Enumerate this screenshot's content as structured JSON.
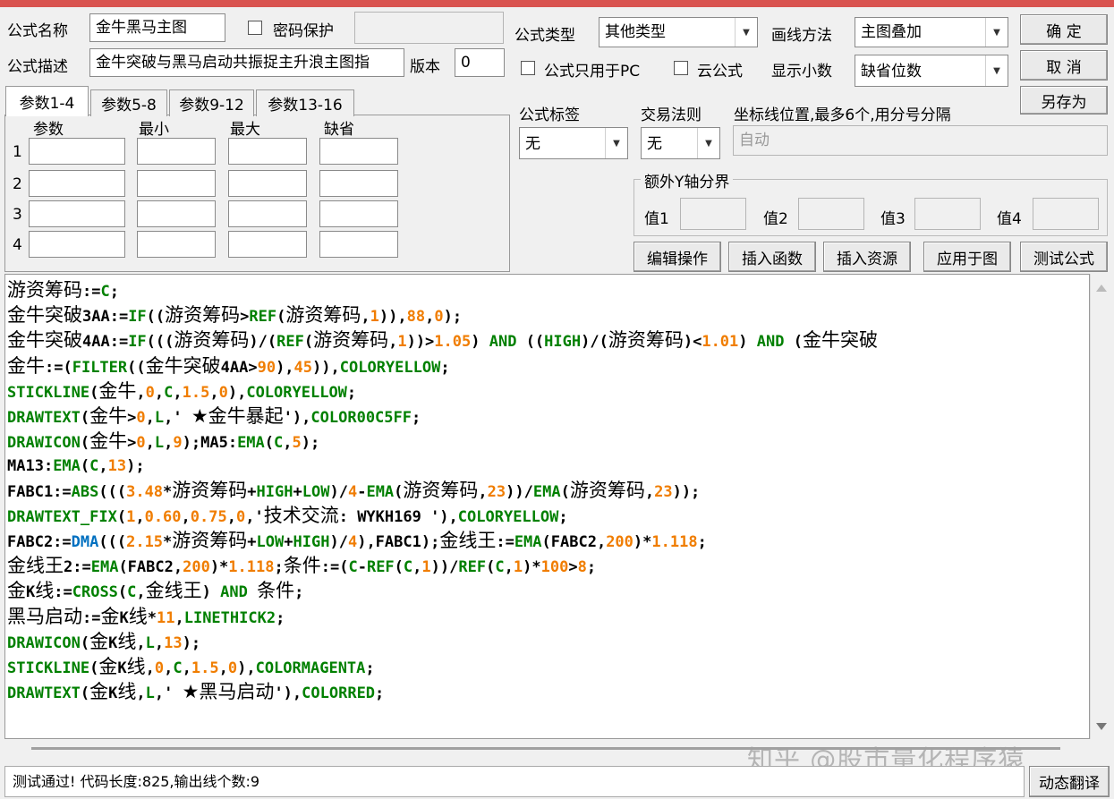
{
  "header": {
    "name_label": "公式名称",
    "name_value": "金牛黑马主图",
    "password_label": "密码保护",
    "password_value": "",
    "desc_label": "公式描述",
    "desc_value": "金牛突破与黑马启动共振捉主升浪主图指",
    "version_label": "版本",
    "version_value": "0",
    "type_label": "公式类型",
    "type_value": "其他类型",
    "draw_label": "画线方法",
    "draw_value": "主图叠加",
    "pc_only_label": "公式只用于PC",
    "cloud_label": "云公式",
    "decimal_label": "显示小数",
    "decimal_value": "缺省位数"
  },
  "buttons": {
    "ok": "确  定",
    "cancel": "取  消",
    "save_as": "另存为",
    "edit_ops": "编辑操作",
    "insert_func": "插入函数",
    "insert_res": "插入资源",
    "apply_chart": "应用于图",
    "test": "测试公式",
    "translate": "动态翻译"
  },
  "tabs": [
    "参数1-4",
    "参数5-8",
    "参数9-12",
    "参数13-16"
  ],
  "params": {
    "headers": [
      "参数",
      "最小",
      "最大",
      "缺省"
    ],
    "rows": [
      "1",
      "2",
      "3",
      "4"
    ]
  },
  "right_panel": {
    "tag_label": "公式标签",
    "tag_value": "无",
    "rule_label": "交易法则",
    "rule_value": "无",
    "coord_label": "坐标线位置,最多6个,用分号分隔",
    "coord_value": "自动",
    "yaxis_label": "额外Y轴分界",
    "val1": "值1",
    "val2": "值2",
    "val3": "值3",
    "val4": "值4"
  },
  "code_lines": [
    [
      [
        "t",
        "游资筹码:="
      ],
      [
        "k",
        "C"
      ],
      [
        "t",
        ";"
      ]
    ],
    [
      [
        "t",
        "金牛突破3AA:="
      ],
      [
        "k",
        "IF"
      ],
      [
        "t",
        "((游资筹码>"
      ],
      [
        "k",
        "REF"
      ],
      [
        "t",
        "(游资筹码,"
      ],
      [
        "n",
        "1"
      ],
      [
        "t",
        ")),"
      ],
      [
        "n",
        "88"
      ],
      [
        "t",
        ","
      ],
      [
        "n",
        "0"
      ],
      [
        "t",
        ");"
      ]
    ],
    [
      [
        "t",
        "金牛突破4AA:="
      ],
      [
        "k",
        "IF"
      ],
      [
        "t",
        "(((游资筹码)/("
      ],
      [
        "k",
        "REF"
      ],
      [
        "t",
        "(游资筹码,"
      ],
      [
        "n",
        "1"
      ],
      [
        "t",
        "))>"
      ],
      [
        "n",
        "1.05"
      ],
      [
        "t",
        ") "
      ],
      [
        "k",
        "AND"
      ],
      [
        "t",
        " (("
      ],
      [
        "k",
        "HIGH"
      ],
      [
        "t",
        ")/(游资筹码)<"
      ],
      [
        "n",
        "1.01"
      ],
      [
        "t",
        ") "
      ],
      [
        "k",
        "AND"
      ],
      [
        "t",
        " (金牛突破"
      ]
    ],
    [
      [
        "t",
        "金牛:=("
      ],
      [
        "k",
        "FILTER"
      ],
      [
        "t",
        "((金牛突破4AA>"
      ],
      [
        "n",
        "90"
      ],
      [
        "t",
        "),"
      ],
      [
        "n",
        "45"
      ],
      [
        "t",
        ")),"
      ],
      [
        "k",
        "COLORYELLOW"
      ],
      [
        "t",
        ";"
      ]
    ],
    [
      [
        "k",
        "STICKLINE"
      ],
      [
        "t",
        "(金牛,"
      ],
      [
        "n",
        "0"
      ],
      [
        "t",
        ","
      ],
      [
        "k",
        "C"
      ],
      [
        "t",
        ","
      ],
      [
        "n",
        "1.5"
      ],
      [
        "t",
        ","
      ],
      [
        "n",
        "0"
      ],
      [
        "t",
        "),"
      ],
      [
        "k",
        "COLORYELLOW"
      ],
      [
        "t",
        ";"
      ]
    ],
    [
      [
        "k",
        "DRAWTEXT"
      ],
      [
        "t",
        "(金牛>"
      ],
      [
        "n",
        "0"
      ],
      [
        "t",
        ","
      ],
      [
        "k",
        "L"
      ],
      [
        "t",
        ",' ★金牛暴起'),"
      ],
      [
        "k",
        "COLOR00C5FF"
      ],
      [
        "t",
        ";"
      ]
    ],
    [
      [
        "k",
        "DRAWICON"
      ],
      [
        "t",
        "(金牛>"
      ],
      [
        "n",
        "0"
      ],
      [
        "t",
        ","
      ],
      [
        "k",
        "L"
      ],
      [
        "t",
        ","
      ],
      [
        "n",
        "9"
      ],
      [
        "t",
        ");MA5:"
      ],
      [
        "k",
        "EMA"
      ],
      [
        "t",
        "("
      ],
      [
        "k",
        "C"
      ],
      [
        "t",
        ","
      ],
      [
        "n",
        "5"
      ],
      [
        "t",
        ");"
      ]
    ],
    [
      [
        "t",
        "MA13:"
      ],
      [
        "k",
        "EMA"
      ],
      [
        "t",
        "("
      ],
      [
        "k",
        "C"
      ],
      [
        "t",
        ","
      ],
      [
        "n",
        "13"
      ],
      [
        "t",
        ");"
      ]
    ],
    [
      [
        "t",
        "FABC1:="
      ],
      [
        "k",
        "ABS"
      ],
      [
        "t",
        "((("
      ],
      [
        "n",
        "3.48"
      ],
      [
        "t",
        "*游资筹码+"
      ],
      [
        "k",
        "HIGH"
      ],
      [
        "t",
        "+"
      ],
      [
        "k",
        "LOW"
      ],
      [
        "t",
        ")/"
      ],
      [
        "n",
        "4"
      ],
      [
        "t",
        "-"
      ],
      [
        "k",
        "EMA"
      ],
      [
        "t",
        "(游资筹码,"
      ],
      [
        "n",
        "23"
      ],
      [
        "t",
        "))/"
      ],
      [
        "k",
        "EMA"
      ],
      [
        "t",
        "(游资筹码,"
      ],
      [
        "n",
        "23"
      ],
      [
        "t",
        "));"
      ]
    ],
    [
      [
        "k",
        "DRAWTEXT_FIX"
      ],
      [
        "t",
        "("
      ],
      [
        "n",
        "1"
      ],
      [
        "t",
        ","
      ],
      [
        "n",
        "0.60"
      ],
      [
        "t",
        ","
      ],
      [
        "n",
        "0.75"
      ],
      [
        "t",
        ","
      ],
      [
        "n",
        "0"
      ],
      [
        "t",
        ",'技术交流: WYKH169 '),"
      ],
      [
        "k",
        "COLORYELLOW"
      ],
      [
        "t",
        ";"
      ]
    ],
    [
      [
        "t",
        "FABC2:="
      ],
      [
        "d",
        "DMA"
      ],
      [
        "t",
        "((("
      ],
      [
        "n",
        "2.15"
      ],
      [
        "t",
        "*游资筹码+"
      ],
      [
        "k",
        "LOW"
      ],
      [
        "t",
        "+"
      ],
      [
        "k",
        "HIGH"
      ],
      [
        "t",
        ")/"
      ],
      [
        "n",
        "4"
      ],
      [
        "t",
        "),FABC1);金线王:="
      ],
      [
        "k",
        "EMA"
      ],
      [
        "t",
        "(FABC2,"
      ],
      [
        "n",
        "200"
      ],
      [
        "t",
        ")*"
      ],
      [
        "n",
        "1.118"
      ],
      [
        "t",
        ";"
      ]
    ],
    [
      [
        "t",
        "金线王2:="
      ],
      [
        "k",
        "EMA"
      ],
      [
        "t",
        "(FABC2,"
      ],
      [
        "n",
        "200"
      ],
      [
        "t",
        ")*"
      ],
      [
        "n",
        "1.118"
      ],
      [
        "t",
        ";条件:=("
      ],
      [
        "k",
        "C"
      ],
      [
        "t",
        "-"
      ],
      [
        "k",
        "REF"
      ],
      [
        "t",
        "("
      ],
      [
        "k",
        "C"
      ],
      [
        "t",
        ","
      ],
      [
        "n",
        "1"
      ],
      [
        "t",
        "))/"
      ],
      [
        "k",
        "REF"
      ],
      [
        "t",
        "("
      ],
      [
        "k",
        "C"
      ],
      [
        "t",
        ","
      ],
      [
        "n",
        "1"
      ],
      [
        "t",
        ")*"
      ],
      [
        "n",
        "100"
      ],
      [
        "t",
        ">"
      ],
      [
        "n",
        "8"
      ],
      [
        "t",
        ";"
      ]
    ],
    [
      [
        "t",
        "金K线:="
      ],
      [
        "k",
        "CROSS"
      ],
      [
        "t",
        "("
      ],
      [
        "k",
        "C"
      ],
      [
        "t",
        ",金线王) "
      ],
      [
        "k",
        "AND"
      ],
      [
        "t",
        " 条件;"
      ]
    ],
    [
      [
        "t",
        "黑马启动:=金K线*"
      ],
      [
        "n",
        "11"
      ],
      [
        "t",
        ","
      ],
      [
        "k",
        "LINETHICK2"
      ],
      [
        "t",
        ";"
      ]
    ],
    [
      [
        "k",
        "DRAWICON"
      ],
      [
        "t",
        "(金K线,"
      ],
      [
        "k",
        "L"
      ],
      [
        "t",
        ","
      ],
      [
        "n",
        "13"
      ],
      [
        "t",
        ");"
      ]
    ],
    [
      [
        "k",
        "STICKLINE"
      ],
      [
        "t",
        "(金K线,"
      ],
      [
        "n",
        "0"
      ],
      [
        "t",
        ","
      ],
      [
        "k",
        "C"
      ],
      [
        "t",
        ","
      ],
      [
        "n",
        "1.5"
      ],
      [
        "t",
        ","
      ],
      [
        "n",
        "0"
      ],
      [
        "t",
        "),"
      ],
      [
        "k",
        "COLORMAGENTA"
      ],
      [
        "t",
        ";"
      ]
    ],
    [
      [
        "k",
        "DRAWTEXT"
      ],
      [
        "t",
        "(金K线,"
      ],
      [
        "k",
        "L"
      ],
      [
        "t",
        ",' ★黑马启动'),"
      ],
      [
        "k",
        "COLORRED"
      ],
      [
        "t",
        ";"
      ]
    ]
  ],
  "status": "测试通过! 代码长度:825,输出线个数:9",
  "watermark": "知乎 @股市量化程序猿",
  "colors": {
    "keyword": "#008000",
    "number": "#f07d00",
    "func_blue": "#0070c0",
    "title_bar": "#d9534f"
  }
}
